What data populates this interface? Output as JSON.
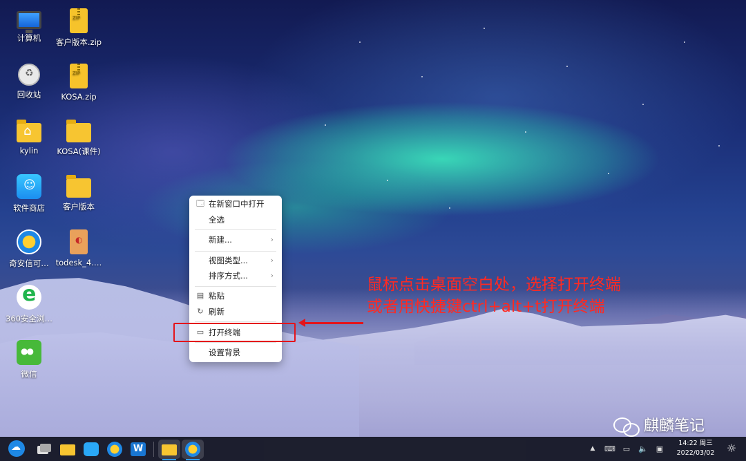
{
  "desktop": {
    "icons": [
      {
        "label": "计算机",
        "icon": "computer-icon"
      },
      {
        "label": "客户版本.zip",
        "icon": "zip-file-icon"
      },
      {
        "label": "回收站",
        "icon": "trash-icon"
      },
      {
        "label": "KOSA.zip",
        "icon": "zip-file-icon"
      },
      {
        "label": "kylin",
        "icon": "home-folder-icon"
      },
      {
        "label": "KOSA(课件)",
        "icon": "folder-icon"
      },
      {
        "label": "软件商店",
        "icon": "software-store-icon"
      },
      {
        "label": "客户版本",
        "icon": "folder-icon"
      },
      {
        "label": "奇安信可…",
        "icon": "qianxin-browser-icon"
      },
      {
        "label": "todesk_4.…",
        "icon": "deb-package-icon"
      },
      {
        "label": "360安全浏…",
        "icon": "browser-360-icon"
      },
      {
        "label": "微信",
        "icon": "wechat-icon"
      }
    ]
  },
  "context_menu": {
    "items": [
      {
        "label": "在新窗口中打开",
        "icon": "window-icon"
      },
      {
        "label": "全选"
      },
      {
        "label": "新建...",
        "submenu_icon": "chevron-right-icon",
        "arrow": "›"
      },
      {
        "label": "视图类型...",
        "submenu_icon": "chevron-right-icon",
        "arrow": "›"
      },
      {
        "label": "排序方式...",
        "submenu_icon": "chevron-right-icon",
        "arrow": "›"
      },
      {
        "label": "粘贴",
        "icon": "clipboard-icon"
      },
      {
        "label": "刷新",
        "icon": "refresh-icon"
      },
      {
        "label": "打开终端",
        "icon": "terminal-icon"
      },
      {
        "label": "设置背景"
      }
    ]
  },
  "annotation": {
    "line1": "鼠标点击桌面空白处，选择打开终端",
    "line2": "或者用快捷键ctrl+alt+t打开终端",
    "color": "#e4141b"
  },
  "watermark": {
    "text": "麒麟笔记"
  },
  "taskbar": {
    "apps": [
      {
        "name": "start-menu",
        "icon": "kylin-start-icon"
      },
      {
        "name": "multitask-view",
        "icon": "multitask-icon"
      },
      {
        "name": "file-manager",
        "icon": "folder-icon"
      },
      {
        "name": "software-store",
        "icon": "software-store-icon"
      },
      {
        "name": "browser",
        "icon": "qianxin-browser-icon"
      },
      {
        "name": "wps",
        "icon": "wps-icon"
      },
      {
        "name": "file-manager-open",
        "icon": "folder-icon"
      },
      {
        "name": "browser-open",
        "icon": "qianxin-browser-icon"
      }
    ],
    "tray": {
      "expand": "▲",
      "keyboard": "⌨",
      "notification": "▭",
      "volume": "🔈",
      "network": "▣"
    },
    "clock": {
      "time": "14:22 周三",
      "date": "2022/03/02"
    },
    "show_desktop": "☼"
  }
}
